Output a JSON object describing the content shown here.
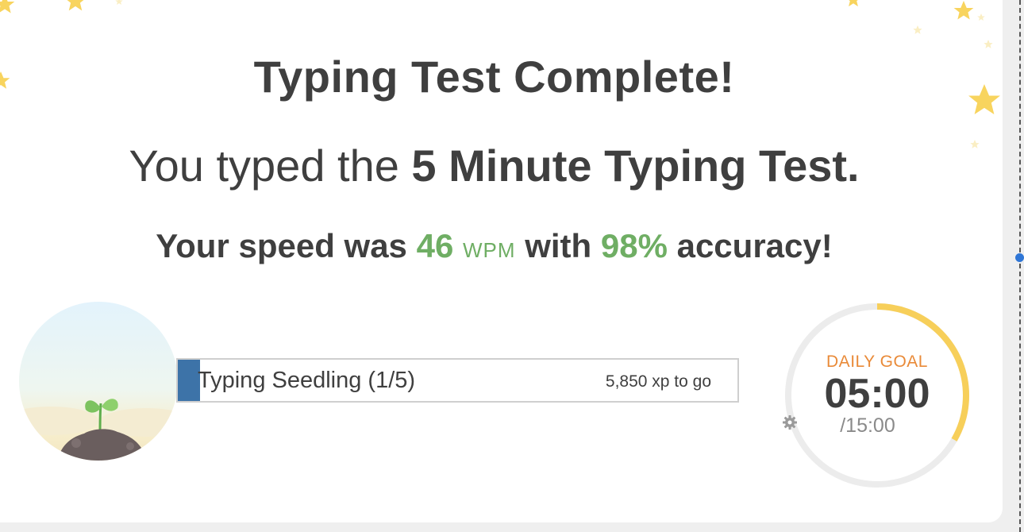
{
  "results": {
    "title": "Typing Test Complete!",
    "subtitle_prefix": "You typed the ",
    "test_name": "5 Minute Typing Test.",
    "speed_prefix": "Your speed was ",
    "wpm_value": "46",
    "wpm_unit": "WPM",
    "speed_middle": " with ",
    "accuracy_value": "98%",
    "speed_suffix": " accuracy!"
  },
  "level": {
    "name": "Typing Seedling (1/5)",
    "xp_remaining_text": "5,850 xp to go",
    "progress_fraction": 0.04,
    "fill_color": "#3d73a8"
  },
  "daily_goal": {
    "label": "DAILY GOAL",
    "time": "05:00",
    "total": "/15:00",
    "progress_fraction": 0.333,
    "ring_color": "#f7cf5a",
    "track_color": "#ececec",
    "settings_icon": "gear-icon"
  },
  "colors": {
    "accent_green": "#6fae64",
    "goal_orange": "#e98a38",
    "text_dark": "#3f3f3f",
    "star_yellow": "#f8d45e"
  }
}
